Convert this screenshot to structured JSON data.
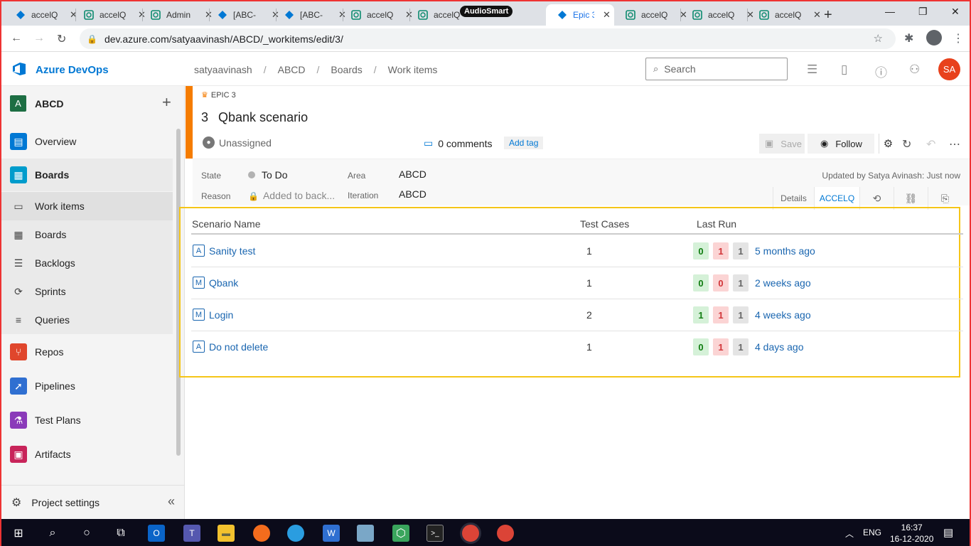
{
  "browser": {
    "tabs": [
      {
        "title": "accelQ",
        "icon": "azure-icon"
      },
      {
        "title": "accelQ",
        "icon": "accelq-icon"
      },
      {
        "title": "Admin",
        "icon": "accelq-icon"
      },
      {
        "title": "[ABC-",
        "icon": "azure-icon"
      },
      {
        "title": "[ABC-",
        "icon": "azure-icon"
      },
      {
        "title": "accelQ",
        "icon": "accelq-icon"
      },
      {
        "title": "accelQ",
        "icon": "accelq-icon"
      },
      {
        "title": "Epic 3",
        "icon": "azure-icon",
        "active": true
      },
      {
        "title": "accelQ",
        "icon": "accelq-icon"
      },
      {
        "title": "accelQ",
        "icon": "accelq-icon"
      },
      {
        "title": "accelQ",
        "icon": "accelq-icon"
      }
    ],
    "audio_badge": "AudioSmart",
    "url": "dev.azure.com/satyaavinash/ABCD/_workitems/edit/3/"
  },
  "header": {
    "product": "Azure DevOps",
    "breadcrumb": [
      "satyaavinash",
      "ABCD",
      "Boards",
      "Work items"
    ],
    "search_placeholder": "Search",
    "avatar_initials": "SA"
  },
  "sidebar": {
    "project_initial": "A",
    "project_name": "ABCD",
    "items": [
      {
        "label": "Overview"
      },
      {
        "label": "Boards"
      },
      {
        "label": "Work items"
      },
      {
        "label": "Boards"
      },
      {
        "label": "Backlogs"
      },
      {
        "label": "Sprints"
      },
      {
        "label": "Queries"
      },
      {
        "label": "Repos"
      },
      {
        "label": "Pipelines"
      },
      {
        "label": "Test Plans"
      },
      {
        "label": "Artifacts"
      }
    ],
    "settings_label": "Project settings"
  },
  "workitem": {
    "type_label": "EPIC 3",
    "id": "3",
    "title": "Qbank scenario",
    "assignee": "Unassigned",
    "comments": "0 comments",
    "add_tag": "Add tag",
    "save_label": "Save",
    "follow_label": "Follow",
    "fields": {
      "state_label": "State",
      "state_value": "To Do",
      "reason_label": "Reason",
      "reason_value": "Added to back...",
      "area_label": "Area",
      "area_value": "ABCD",
      "iteration_label": "Iteration",
      "iteration_value": "ABCD"
    },
    "updated": "Updated by Satya Avinash: Just now",
    "tabs": {
      "details": "Details",
      "accelq": "ACCELQ"
    }
  },
  "accelq": {
    "headers": {
      "name": "Scenario Name",
      "cases": "Test Cases",
      "last_run": "Last Run"
    },
    "rows": [
      {
        "badge": "A",
        "name": "Sanity test",
        "cases": "1",
        "pass": "0",
        "fail": "1",
        "other": "1",
        "when": "5 months ago"
      },
      {
        "badge": "M",
        "name": "Qbank",
        "cases": "1",
        "pass": "0",
        "fail": "0",
        "other": "1",
        "when": "2 weeks ago"
      },
      {
        "badge": "M",
        "name": "Login",
        "cases": "2",
        "pass": "1",
        "fail": "1",
        "other": "1",
        "when": "4 weeks ago"
      },
      {
        "badge": "A",
        "name": "Do not delete",
        "cases": "1",
        "pass": "0",
        "fail": "1",
        "other": "1",
        "when": "4 days ago"
      }
    ]
  },
  "taskbar": {
    "lang": "ENG",
    "time": "16:37",
    "date": "16-12-2020"
  }
}
